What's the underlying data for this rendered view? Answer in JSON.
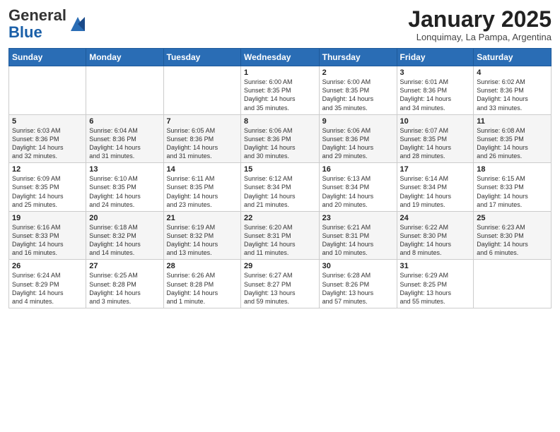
{
  "logo": {
    "general": "General",
    "blue": "Blue"
  },
  "title": "January 2025",
  "subtitle": "Lonquimay, La Pampa, Argentina",
  "weekdays": [
    "Sunday",
    "Monday",
    "Tuesday",
    "Wednesday",
    "Thursday",
    "Friday",
    "Saturday"
  ],
  "weeks": [
    [
      {
        "day": "",
        "content": ""
      },
      {
        "day": "",
        "content": ""
      },
      {
        "day": "",
        "content": ""
      },
      {
        "day": "1",
        "content": "Sunrise: 6:00 AM\nSunset: 8:35 PM\nDaylight: 14 hours\nand 35 minutes."
      },
      {
        "day": "2",
        "content": "Sunrise: 6:00 AM\nSunset: 8:35 PM\nDaylight: 14 hours\nand 35 minutes."
      },
      {
        "day": "3",
        "content": "Sunrise: 6:01 AM\nSunset: 8:36 PM\nDaylight: 14 hours\nand 34 minutes."
      },
      {
        "day": "4",
        "content": "Sunrise: 6:02 AM\nSunset: 8:36 PM\nDaylight: 14 hours\nand 33 minutes."
      }
    ],
    [
      {
        "day": "5",
        "content": "Sunrise: 6:03 AM\nSunset: 8:36 PM\nDaylight: 14 hours\nand 32 minutes."
      },
      {
        "day": "6",
        "content": "Sunrise: 6:04 AM\nSunset: 8:36 PM\nDaylight: 14 hours\nand 31 minutes."
      },
      {
        "day": "7",
        "content": "Sunrise: 6:05 AM\nSunset: 8:36 PM\nDaylight: 14 hours\nand 31 minutes."
      },
      {
        "day": "8",
        "content": "Sunrise: 6:06 AM\nSunset: 8:36 PM\nDaylight: 14 hours\nand 30 minutes."
      },
      {
        "day": "9",
        "content": "Sunrise: 6:06 AM\nSunset: 8:36 PM\nDaylight: 14 hours\nand 29 minutes."
      },
      {
        "day": "10",
        "content": "Sunrise: 6:07 AM\nSunset: 8:35 PM\nDaylight: 14 hours\nand 28 minutes."
      },
      {
        "day": "11",
        "content": "Sunrise: 6:08 AM\nSunset: 8:35 PM\nDaylight: 14 hours\nand 26 minutes."
      }
    ],
    [
      {
        "day": "12",
        "content": "Sunrise: 6:09 AM\nSunset: 8:35 PM\nDaylight: 14 hours\nand 25 minutes."
      },
      {
        "day": "13",
        "content": "Sunrise: 6:10 AM\nSunset: 8:35 PM\nDaylight: 14 hours\nand 24 minutes."
      },
      {
        "day": "14",
        "content": "Sunrise: 6:11 AM\nSunset: 8:35 PM\nDaylight: 14 hours\nand 23 minutes."
      },
      {
        "day": "15",
        "content": "Sunrise: 6:12 AM\nSunset: 8:34 PM\nDaylight: 14 hours\nand 21 minutes."
      },
      {
        "day": "16",
        "content": "Sunrise: 6:13 AM\nSunset: 8:34 PM\nDaylight: 14 hours\nand 20 minutes."
      },
      {
        "day": "17",
        "content": "Sunrise: 6:14 AM\nSunset: 8:34 PM\nDaylight: 14 hours\nand 19 minutes."
      },
      {
        "day": "18",
        "content": "Sunrise: 6:15 AM\nSunset: 8:33 PM\nDaylight: 14 hours\nand 17 minutes."
      }
    ],
    [
      {
        "day": "19",
        "content": "Sunrise: 6:16 AM\nSunset: 8:33 PM\nDaylight: 14 hours\nand 16 minutes."
      },
      {
        "day": "20",
        "content": "Sunrise: 6:18 AM\nSunset: 8:32 PM\nDaylight: 14 hours\nand 14 minutes."
      },
      {
        "day": "21",
        "content": "Sunrise: 6:19 AM\nSunset: 8:32 PM\nDaylight: 14 hours\nand 13 minutes."
      },
      {
        "day": "22",
        "content": "Sunrise: 6:20 AM\nSunset: 8:31 PM\nDaylight: 14 hours\nand 11 minutes."
      },
      {
        "day": "23",
        "content": "Sunrise: 6:21 AM\nSunset: 8:31 PM\nDaylight: 14 hours\nand 10 minutes."
      },
      {
        "day": "24",
        "content": "Sunrise: 6:22 AM\nSunset: 8:30 PM\nDaylight: 14 hours\nand 8 minutes."
      },
      {
        "day": "25",
        "content": "Sunrise: 6:23 AM\nSunset: 8:30 PM\nDaylight: 14 hours\nand 6 minutes."
      }
    ],
    [
      {
        "day": "26",
        "content": "Sunrise: 6:24 AM\nSunset: 8:29 PM\nDaylight: 14 hours\nand 4 minutes."
      },
      {
        "day": "27",
        "content": "Sunrise: 6:25 AM\nSunset: 8:28 PM\nDaylight: 14 hours\nand 3 minutes."
      },
      {
        "day": "28",
        "content": "Sunrise: 6:26 AM\nSunset: 8:28 PM\nDaylight: 14 hours\nand 1 minute."
      },
      {
        "day": "29",
        "content": "Sunrise: 6:27 AM\nSunset: 8:27 PM\nDaylight: 13 hours\nand 59 minutes."
      },
      {
        "day": "30",
        "content": "Sunrise: 6:28 AM\nSunset: 8:26 PM\nDaylight: 13 hours\nand 57 minutes."
      },
      {
        "day": "31",
        "content": "Sunrise: 6:29 AM\nSunset: 8:25 PM\nDaylight: 13 hours\nand 55 minutes."
      },
      {
        "day": "",
        "content": ""
      }
    ]
  ]
}
